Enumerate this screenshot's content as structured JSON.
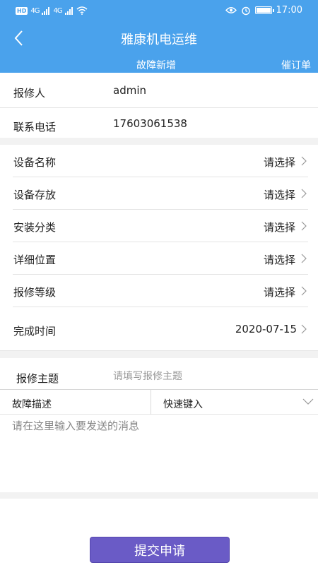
{
  "status_bar": {
    "hd_label": "HD",
    "network_1": "4G",
    "network_2": "4G",
    "time": "17:00"
  },
  "nav": {
    "title": "雅康机电运维",
    "tabs": [
      {
        "label": "故障新增"
      },
      {
        "label": "催订单"
      }
    ]
  },
  "form": {
    "reporter": {
      "label": "报修人",
      "value": "admin"
    },
    "phone": {
      "label": "联系电话",
      "value": "17603061538"
    },
    "selects": [
      {
        "label": "设备名称",
        "value": "请选择"
      },
      {
        "label": "设备存放",
        "value": "请选择"
      },
      {
        "label": "安装分类",
        "value": "请选择"
      },
      {
        "label": "详细位置",
        "value": "请选择"
      },
      {
        "label": "报修等级",
        "value": "请选择"
      }
    ],
    "finish_time": {
      "label": "完成时间",
      "value": "2020-07-15"
    },
    "subject": {
      "label": "报修主题",
      "placeholder": "请填写报修主题"
    },
    "description": {
      "label": "故障描述",
      "quick_input": "快速键入",
      "placeholder": "请在这里输入要发送的消息"
    }
  },
  "submit_label": "提交申请",
  "colors": {
    "header": "#4aa2ec",
    "submit": "#6a5bc6",
    "background_gap": "#f2f2f2"
  }
}
